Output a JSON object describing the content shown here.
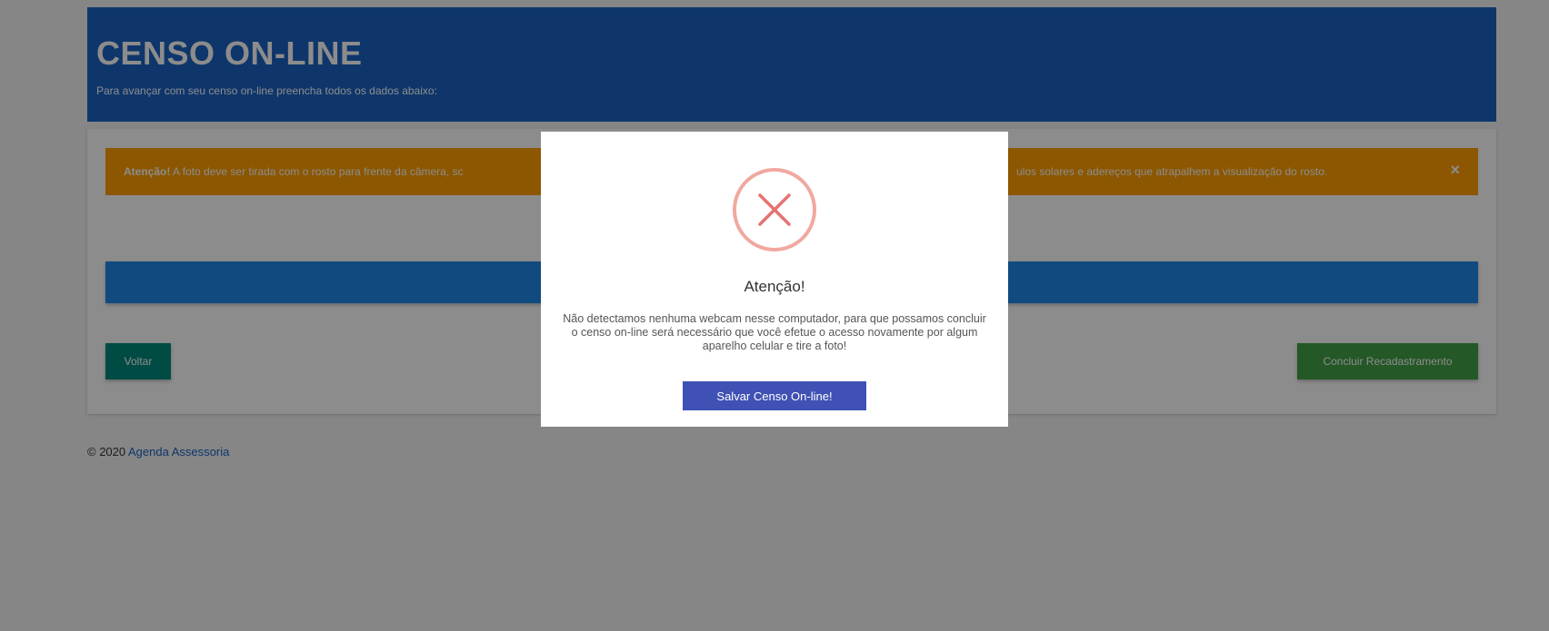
{
  "header": {
    "title": "CENSO ON-LINE",
    "subtitle": "Para avançar com seu censo on-line preencha todos os dados abaixo:"
  },
  "alert": {
    "label": "Atenção!",
    "text_left": " A foto deve ser tirada com o rosto para frente da câmera, sc",
    "text_right": "ulos solares e adereços que atrapalhem a visualização do rosto.",
    "close": "×"
  },
  "buttons": {
    "back": "Voltar",
    "finish": "Concluir Recadastramento"
  },
  "footer": {
    "copyright": "© 2020 ",
    "link": "Agenda Assessoria"
  },
  "modal": {
    "icon": "error-x-icon",
    "title": "Atenção!",
    "message": "Não detectamos nenhuma webcam nesse computador, para que possamos concluir o censo on-line será necessário que você efetue o acesso novamente por algum aparelho celular e tire a foto!",
    "button": "Salvar Censo On-line!"
  }
}
